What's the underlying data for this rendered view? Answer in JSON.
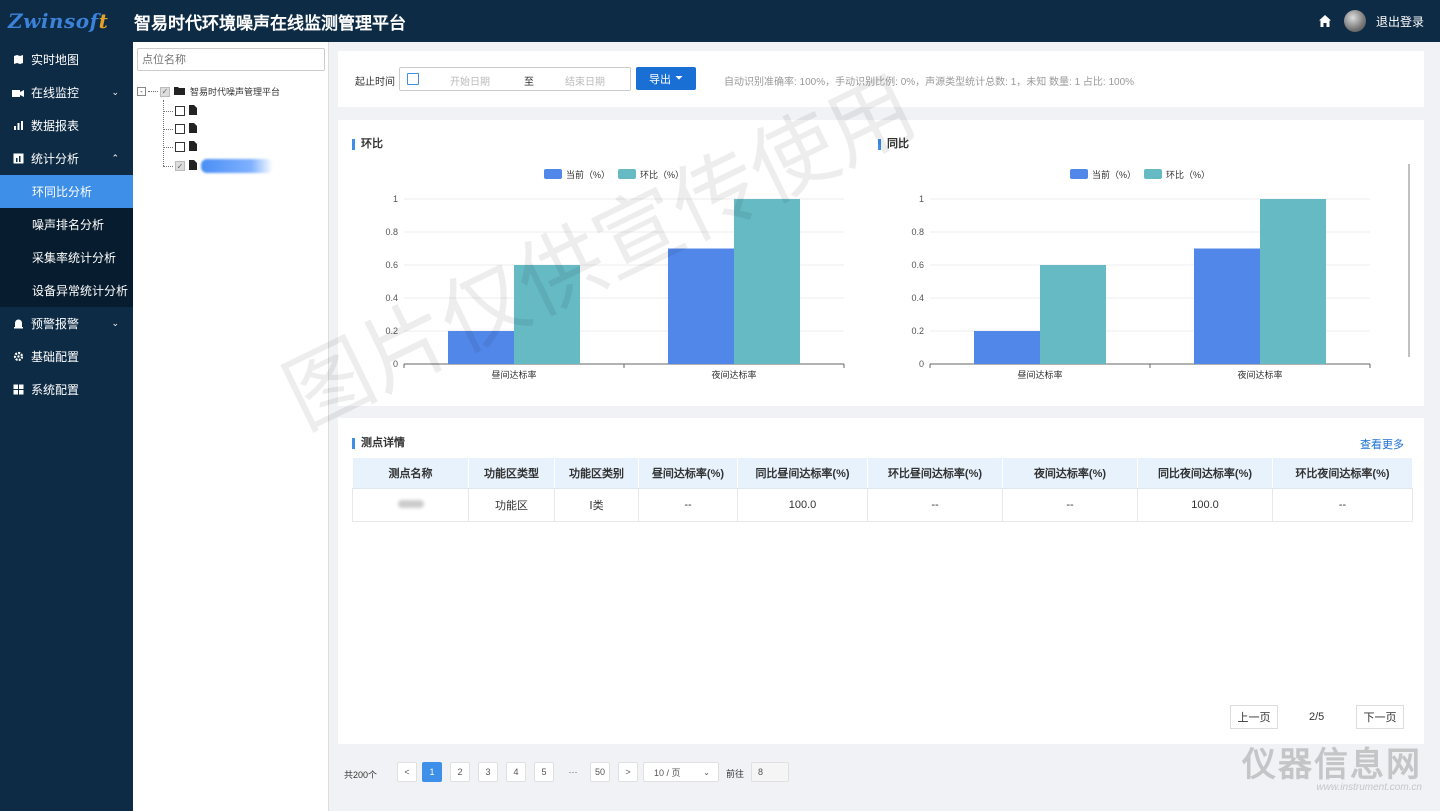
{
  "header": {
    "logo_main": "Zwinsof",
    "logo_tail": "t",
    "title": "智易时代环境噪声在线监测管理平台",
    "logout": "退出登录"
  },
  "sidebar": {
    "items": [
      {
        "label": "实时地图",
        "icon": "map-icon"
      },
      {
        "label": "在线监控",
        "icon": "camera-icon"
      },
      {
        "label": "数据报表",
        "icon": "bar-chart-icon"
      },
      {
        "label": "统计分析",
        "icon": "stats-icon"
      },
      {
        "label": "预警报警",
        "icon": "alarm-icon"
      },
      {
        "label": "基础配置",
        "icon": "gear-icon"
      },
      {
        "label": "系统配置",
        "icon": "windows-icon"
      }
    ],
    "sub_items": [
      {
        "label": "环同比分析",
        "active": true
      },
      {
        "label": "噪声排名分析",
        "active": false
      },
      {
        "label": "采集率统计分析",
        "active": false
      },
      {
        "label": "设备异常统计分析",
        "active": false
      }
    ]
  },
  "tree": {
    "search_placeholder": "点位名称",
    "root_label": "智易时代噪声管理平台"
  },
  "filter": {
    "time_label": "起止时间",
    "start_placeholder": "开始日期",
    "separator": "至",
    "end_placeholder": "结束日期",
    "export_label": "导出",
    "stats_text": "自动识别准确率: 100%，手动识别比例: 0%，声源类型统计总数: 1，未知 数量: 1 占比: 100%"
  },
  "charts_section": {
    "left_title": "环比",
    "right_title": "同比"
  },
  "chart_data": [
    {
      "type": "bar",
      "title": "环比",
      "categories": [
        "昼间达标率",
        "夜间达标率"
      ],
      "series": [
        {
          "name": "当前（%）",
          "values": [
            0.2,
            0.7
          ],
          "color": "#5287ea"
        },
        {
          "name": "环比（%）",
          "values": [
            0.6,
            1.0
          ],
          "color": "#66bac4"
        }
      ],
      "ylim": [
        0,
        1
      ],
      "yticks": [
        "0",
        "0.2",
        "0.4",
        "0.6",
        "0.8",
        "1"
      ],
      "legend": "top-center",
      "grid": true
    },
    {
      "type": "bar",
      "title": "同比",
      "categories": [
        "昼间达标率",
        "夜间达标率"
      ],
      "series": [
        {
          "name": "当前（%）",
          "values": [
            0.2,
            0.7
          ],
          "color": "#5287ea"
        },
        {
          "name": "环比（%）",
          "values": [
            0.6,
            1.0
          ],
          "color": "#66bac4"
        }
      ],
      "ylim": [
        0,
        1
      ],
      "yticks": [
        "0",
        "0.2",
        "0.4",
        "0.6",
        "0.8",
        "1"
      ],
      "legend": "top-center",
      "grid": true
    }
  ],
  "details": {
    "title": "测点详情",
    "view_more": "查看更多",
    "columns": [
      "测点名称",
      "功能区类型",
      "功能区类别",
      "昼间达标率(%)",
      "同比昼间达标率(%)",
      "环比昼间达标率(%)",
      "夜间达标率(%)",
      "同比夜间达标率(%)",
      "环比夜间达标率(%)"
    ],
    "rows": [
      [
        "",
        "功能区",
        "Ⅰ类",
        "--",
        "100.0",
        "--",
        "--",
        "100.0",
        "--"
      ]
    ],
    "prev_label": "上一页",
    "page_indicator": "2/5",
    "next_label": "下一页"
  },
  "pagination": {
    "total": "共200个",
    "pages": [
      "1",
      "2",
      "3",
      "4",
      "5",
      "···",
      "50"
    ],
    "active_page": "1",
    "page_size": "10 / 页",
    "goto_label": "前往",
    "goto_value": "8"
  },
  "watermark": "图片仅供宣传使用",
  "corner_watermark": {
    "title": "仪器信息网",
    "url": "www.instrument.com.cn"
  }
}
